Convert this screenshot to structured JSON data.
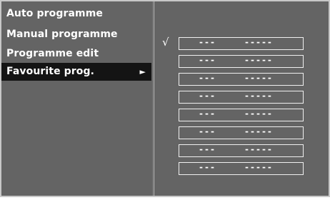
{
  "menu": {
    "items": [
      {
        "label": "Auto programme",
        "selected": false
      },
      {
        "label": "Manual programme",
        "selected": false
      },
      {
        "label": "Programme edit",
        "selected": false
      },
      {
        "label": "Favourite prog.",
        "selected": true
      }
    ],
    "submenu_arrow": "►"
  },
  "favourites": {
    "check_mark": "√",
    "rows": [
      {
        "number": "---",
        "name": "-----"
      },
      {
        "number": "---",
        "name": "-----"
      },
      {
        "number": "---",
        "name": "-----"
      },
      {
        "number": "---",
        "name": "-----"
      },
      {
        "number": "---",
        "name": "-----"
      },
      {
        "number": "---",
        "name": "-----"
      },
      {
        "number": "---",
        "name": "-----"
      },
      {
        "number": "---",
        "name": "-----"
      }
    ]
  },
  "colors": {
    "panel_background": "#646464",
    "selected_background": "#141414",
    "text": "#ffffff"
  }
}
